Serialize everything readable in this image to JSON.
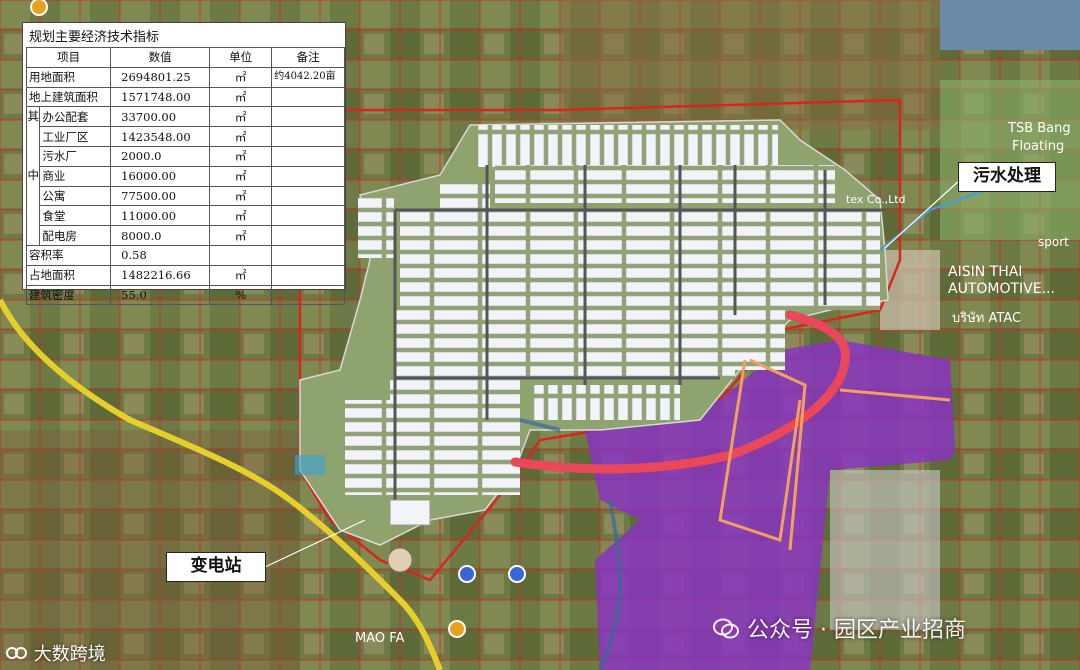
{
  "table": {
    "title": "规划主要经济技术指标",
    "headers": [
      "项目",
      "数值",
      "单位",
      "备注"
    ],
    "rows": [
      {
        "item": "用地面积",
        "value": "2694801.25",
        "unit": "㎡",
        "note": "约4042.20亩"
      },
      {
        "item": "地上建筑面积",
        "value": "1571748.00",
        "unit": "㎡",
        "note": ""
      }
    ],
    "group_label_1": "其",
    "group_label_2": "中",
    "group_rows": [
      {
        "item": "办公配套",
        "value": "33700.00",
        "unit": "㎡"
      },
      {
        "item": "工业厂区",
        "value": "1423548.00",
        "unit": "㎡"
      },
      {
        "item": "污水厂",
        "value": "2000.0",
        "unit": "㎡"
      },
      {
        "item": "商业",
        "value": "16000.00",
        "unit": "㎡"
      },
      {
        "item": "公寓",
        "value": "77500.00",
        "unit": "㎡"
      },
      {
        "item": "食堂",
        "value": "11000.00",
        "unit": "㎡"
      },
      {
        "item": "配电房",
        "value": "8000.0",
        "unit": "㎡"
      }
    ],
    "tail_rows": [
      {
        "item": "容积率",
        "value": "0.58",
        "unit": ""
      },
      {
        "item": "占地面积",
        "value": "1482216.66",
        "unit": "㎡"
      },
      {
        "item": "建筑密度",
        "value": "55.0",
        "unit": "%"
      }
    ]
  },
  "labels": {
    "sewage": "污水处理",
    "substation": "变电站"
  },
  "watermarks": {
    "left": "大数跨境",
    "right": "公众号 · 园区产业招商"
  },
  "map_text": {
    "tsb": "TSB Bang",
    "floating": "Floating",
    "aisin": "AISIN THAI",
    "automotive": "AUTOMOTIVE...",
    "atac": "บริษัท ATAC",
    "sport": "sport",
    "tex": "tex Co.,Ltd",
    "mao": "MAO FA"
  },
  "colors": {
    "purple_zone": "#8a2fc8",
    "red_road": "#e8485a",
    "yellow_road": "#e6cf2a",
    "boundary": "#d8261f"
  }
}
